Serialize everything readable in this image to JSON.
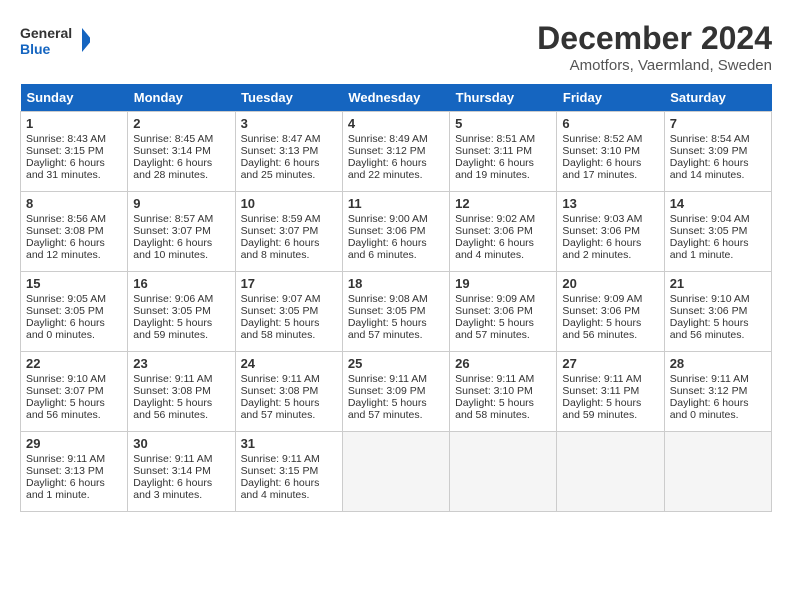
{
  "header": {
    "logo_line1": "General",
    "logo_line2": "Blue",
    "month": "December 2024",
    "location": "Amotfors, Vaermland, Sweden"
  },
  "days_of_week": [
    "Sunday",
    "Monday",
    "Tuesday",
    "Wednesday",
    "Thursday",
    "Friday",
    "Saturday"
  ],
  "weeks": [
    [
      {
        "day": "1",
        "lines": [
          "Sunrise: 8:43 AM",
          "Sunset: 3:15 PM",
          "Daylight: 6 hours",
          "and 31 minutes."
        ]
      },
      {
        "day": "2",
        "lines": [
          "Sunrise: 8:45 AM",
          "Sunset: 3:14 PM",
          "Daylight: 6 hours",
          "and 28 minutes."
        ]
      },
      {
        "day": "3",
        "lines": [
          "Sunrise: 8:47 AM",
          "Sunset: 3:13 PM",
          "Daylight: 6 hours",
          "and 25 minutes."
        ]
      },
      {
        "day": "4",
        "lines": [
          "Sunrise: 8:49 AM",
          "Sunset: 3:12 PM",
          "Daylight: 6 hours",
          "and 22 minutes."
        ]
      },
      {
        "day": "5",
        "lines": [
          "Sunrise: 8:51 AM",
          "Sunset: 3:11 PM",
          "Daylight: 6 hours",
          "and 19 minutes."
        ]
      },
      {
        "day": "6",
        "lines": [
          "Sunrise: 8:52 AM",
          "Sunset: 3:10 PM",
          "Daylight: 6 hours",
          "and 17 minutes."
        ]
      },
      {
        "day": "7",
        "lines": [
          "Sunrise: 8:54 AM",
          "Sunset: 3:09 PM",
          "Daylight: 6 hours",
          "and 14 minutes."
        ]
      }
    ],
    [
      {
        "day": "8",
        "lines": [
          "Sunrise: 8:56 AM",
          "Sunset: 3:08 PM",
          "Daylight: 6 hours",
          "and 12 minutes."
        ]
      },
      {
        "day": "9",
        "lines": [
          "Sunrise: 8:57 AM",
          "Sunset: 3:07 PM",
          "Daylight: 6 hours",
          "and 10 minutes."
        ]
      },
      {
        "day": "10",
        "lines": [
          "Sunrise: 8:59 AM",
          "Sunset: 3:07 PM",
          "Daylight: 6 hours",
          "and 8 minutes."
        ]
      },
      {
        "day": "11",
        "lines": [
          "Sunrise: 9:00 AM",
          "Sunset: 3:06 PM",
          "Daylight: 6 hours",
          "and 6 minutes."
        ]
      },
      {
        "day": "12",
        "lines": [
          "Sunrise: 9:02 AM",
          "Sunset: 3:06 PM",
          "Daylight: 6 hours",
          "and 4 minutes."
        ]
      },
      {
        "day": "13",
        "lines": [
          "Sunrise: 9:03 AM",
          "Sunset: 3:06 PM",
          "Daylight: 6 hours",
          "and 2 minutes."
        ]
      },
      {
        "day": "14",
        "lines": [
          "Sunrise: 9:04 AM",
          "Sunset: 3:05 PM",
          "Daylight: 6 hours",
          "and 1 minute."
        ]
      }
    ],
    [
      {
        "day": "15",
        "lines": [
          "Sunrise: 9:05 AM",
          "Sunset: 3:05 PM",
          "Daylight: 6 hours",
          "and 0 minutes."
        ]
      },
      {
        "day": "16",
        "lines": [
          "Sunrise: 9:06 AM",
          "Sunset: 3:05 PM",
          "Daylight: 5 hours",
          "and 59 minutes."
        ]
      },
      {
        "day": "17",
        "lines": [
          "Sunrise: 9:07 AM",
          "Sunset: 3:05 PM",
          "Daylight: 5 hours",
          "and 58 minutes."
        ]
      },
      {
        "day": "18",
        "lines": [
          "Sunrise: 9:08 AM",
          "Sunset: 3:05 PM",
          "Daylight: 5 hours",
          "and 57 minutes."
        ]
      },
      {
        "day": "19",
        "lines": [
          "Sunrise: 9:09 AM",
          "Sunset: 3:06 PM",
          "Daylight: 5 hours",
          "and 57 minutes."
        ]
      },
      {
        "day": "20",
        "lines": [
          "Sunrise: 9:09 AM",
          "Sunset: 3:06 PM",
          "Daylight: 5 hours",
          "and 56 minutes."
        ]
      },
      {
        "day": "21",
        "lines": [
          "Sunrise: 9:10 AM",
          "Sunset: 3:06 PM",
          "Daylight: 5 hours",
          "and 56 minutes."
        ]
      }
    ],
    [
      {
        "day": "22",
        "lines": [
          "Sunrise: 9:10 AM",
          "Sunset: 3:07 PM",
          "Daylight: 5 hours",
          "and 56 minutes."
        ]
      },
      {
        "day": "23",
        "lines": [
          "Sunrise: 9:11 AM",
          "Sunset: 3:08 PM",
          "Daylight: 5 hours",
          "and 56 minutes."
        ]
      },
      {
        "day": "24",
        "lines": [
          "Sunrise: 9:11 AM",
          "Sunset: 3:08 PM",
          "Daylight: 5 hours",
          "and 57 minutes."
        ]
      },
      {
        "day": "25",
        "lines": [
          "Sunrise: 9:11 AM",
          "Sunset: 3:09 PM",
          "Daylight: 5 hours",
          "and 57 minutes."
        ]
      },
      {
        "day": "26",
        "lines": [
          "Sunrise: 9:11 AM",
          "Sunset: 3:10 PM",
          "Daylight: 5 hours",
          "and 58 minutes."
        ]
      },
      {
        "day": "27",
        "lines": [
          "Sunrise: 9:11 AM",
          "Sunset: 3:11 PM",
          "Daylight: 5 hours",
          "and 59 minutes."
        ]
      },
      {
        "day": "28",
        "lines": [
          "Sunrise: 9:11 AM",
          "Sunset: 3:12 PM",
          "Daylight: 6 hours",
          "and 0 minutes."
        ]
      }
    ],
    [
      {
        "day": "29",
        "lines": [
          "Sunrise: 9:11 AM",
          "Sunset: 3:13 PM",
          "Daylight: 6 hours",
          "and 1 minute."
        ]
      },
      {
        "day": "30",
        "lines": [
          "Sunrise: 9:11 AM",
          "Sunset: 3:14 PM",
          "Daylight: 6 hours",
          "and 3 minutes."
        ]
      },
      {
        "day": "31",
        "lines": [
          "Sunrise: 9:11 AM",
          "Sunset: 3:15 PM",
          "Daylight: 6 hours",
          "and 4 minutes."
        ]
      },
      {
        "day": "",
        "lines": []
      },
      {
        "day": "",
        "lines": []
      },
      {
        "day": "",
        "lines": []
      },
      {
        "day": "",
        "lines": []
      }
    ]
  ]
}
